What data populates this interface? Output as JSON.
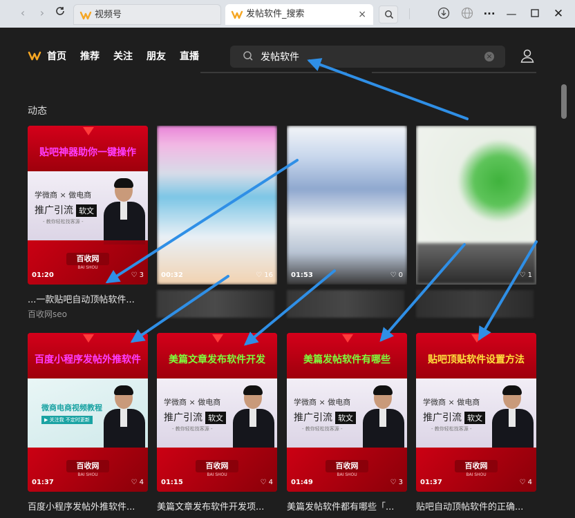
{
  "browser": {
    "tabs": [
      {
        "title": "视频号",
        "active": false
      },
      {
        "title": "发帖软件_搜索",
        "active": true
      }
    ],
    "close_symbol": "×",
    "icons": [
      "back-icon",
      "forward-icon",
      "refresh-icon",
      "search-icon",
      "download-icon",
      "globe-icon",
      "more-icon",
      "minimize-icon",
      "maximize-icon",
      "close-icon"
    ]
  },
  "header": {
    "nav": [
      "首页",
      "推荐",
      "关注",
      "朋友",
      "直播"
    ],
    "search": {
      "value": "发帖软件"
    },
    "clear_symbol": "×"
  },
  "section": {
    "title": "动态"
  },
  "row1": [
    {
      "headline": "贴吧神器助你一键操作",
      "duration": "01:20",
      "likes": "3",
      "title": "...一款贴吧自动顶帖软件...",
      "author": "百收网seo",
      "blurred": false
    },
    {
      "headline": "",
      "duration": "00:32",
      "likes": "16",
      "title": "",
      "author": "",
      "blurred": true
    },
    {
      "headline": "",
      "duration": "01:53",
      "likes": "0",
      "title": "",
      "author": "",
      "blurred": true
    },
    {
      "headline": "",
      "duration": "",
      "likes": "1",
      "title": "",
      "author": "",
      "blurred": true
    }
  ],
  "row2": [
    {
      "headline": "百度小程序发帖外推软件",
      "headline_color": "#ff3cff",
      "duration": "01:37",
      "likes": "4",
      "title": "百度小程序发帖外推软件..."
    },
    {
      "headline": "美篇文章发布软件开发",
      "headline_color": "#7dff3c",
      "duration": "01:15",
      "likes": "4",
      "title": "美篇文章发布软件开发项..."
    },
    {
      "headline": "美篇发帖软件有哪些",
      "headline_color": "#7dff3c",
      "duration": "01:49",
      "likes": "3",
      "title": "美篇发帖软件都有哪些「..."
    },
    {
      "headline": "贴吧顶贴软件设置方法",
      "headline_color": "#ffe23c",
      "duration": "01:37",
      "likes": "4",
      "title": "贴吧自动顶帖软件的正确..."
    }
  ],
  "thumb_text": {
    "line1": "学微商 × 做电商",
    "line2a": "推广引流",
    "line2b": "软文",
    "line3": "- 教你轻松找客源 -",
    "brand": "百收网",
    "brand_sub": "BAI SHOU",
    "alt_line": "微商电商视频教程",
    "alt_btn": "▶ 关注我 不定时更新"
  },
  "colors": {
    "page_bg": "#1e1e1e",
    "arrow": "#2f8fe6",
    "thumb_red": "#c40012"
  }
}
